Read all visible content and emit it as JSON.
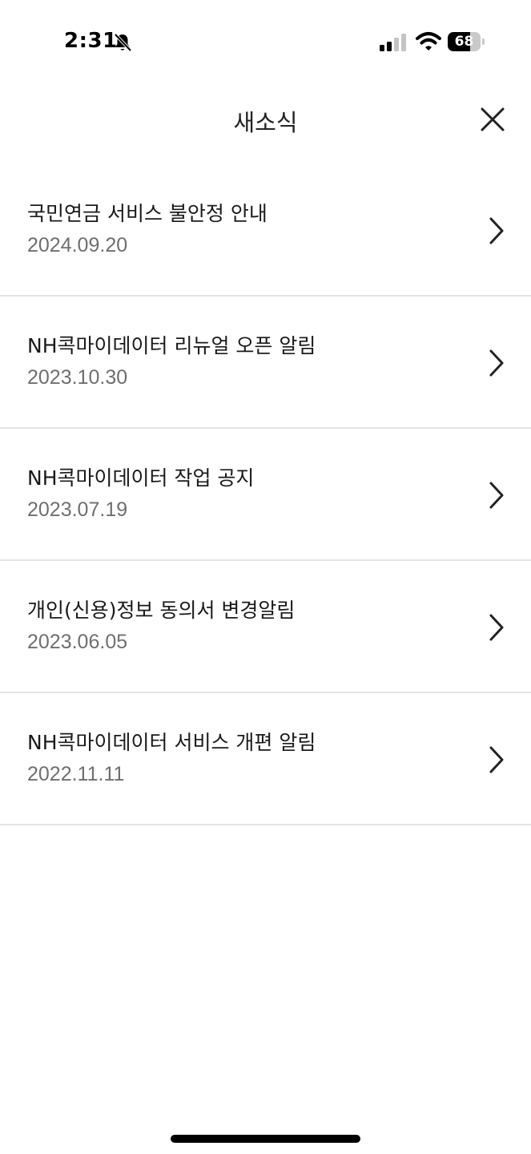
{
  "status_bar": {
    "time": "2:31",
    "battery": "68",
    "battery_level": 0.68
  },
  "header": {
    "title": "새소식",
    "close_icon": "close-icon"
  },
  "news": [
    {
      "title": "국민연금 서비스 불안정 안내",
      "date": "2024.09.20"
    },
    {
      "title": "NH콕마이데이터 리뉴얼 오픈 알림",
      "date": "2023.10.30"
    },
    {
      "title": "NH콕마이데이터 작업 공지",
      "date": "2023.07.19"
    },
    {
      "title": "개인(신용)정보 동의서 변경알림",
      "date": "2023.06.05"
    },
    {
      "title": "NH콕마이데이터 서비스 개편 알림",
      "date": "2022.11.11"
    }
  ],
  "icons": {
    "silent": "bell-slash-icon",
    "signal": "cellular-signal-icon",
    "wifi": "wifi-icon",
    "chevron": "chevron-right-icon"
  },
  "colors": {
    "divider": "#e4e4e4",
    "date_text": "#6f6f6f"
  }
}
